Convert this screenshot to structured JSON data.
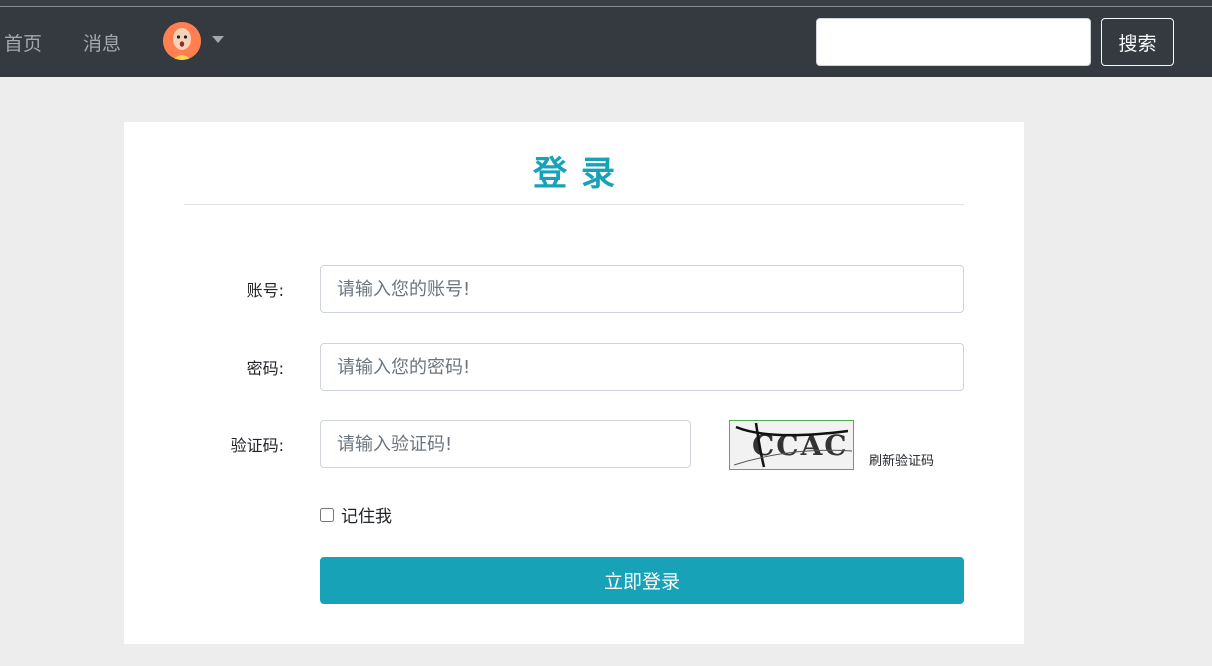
{
  "nav": {
    "home_label": "首页",
    "messages_label": "消息",
    "search_value": "",
    "search_button_label": "搜索"
  },
  "login": {
    "title": "登录",
    "account_label": "账号:",
    "account_placeholder": "请输入您的账号!",
    "password_label": "密码:",
    "password_placeholder": "请输入您的密码!",
    "captcha_label": "验证码:",
    "captcha_placeholder": "请输入验证码!",
    "captcha_text": "CCAC",
    "refresh_label": "刷新验证码",
    "remember_label": "记住我",
    "remember_checked": false,
    "submit_label": "立即登录"
  },
  "colors": {
    "navbar": "#343a40",
    "accent": "#17a2b8",
    "page_bg": "#ededed",
    "avatar_bg": "#ff7f50"
  },
  "icons": {
    "avatar": "cartoon-face-avatar",
    "dropdown": "caret-down-icon"
  }
}
